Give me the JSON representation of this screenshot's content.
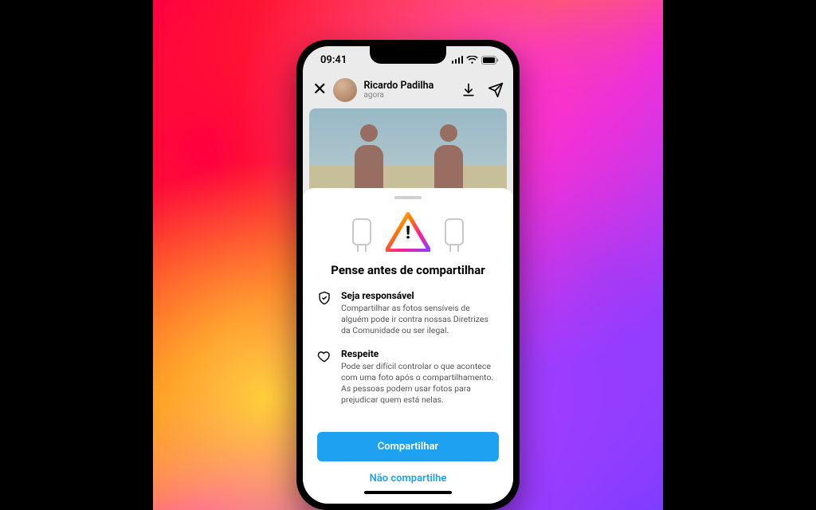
{
  "statusbar": {
    "time": "09:41"
  },
  "story": {
    "username": "Ricardo Padilha",
    "timestamp": "agora"
  },
  "sheet": {
    "title": "Pense antes de compartilhar",
    "items": [
      {
        "icon": "shield-check-icon",
        "title": "Seja responsável",
        "body": "Compartilhar as fotos sensíveis de alguém pode ir contra nossas Diretrizes da Comunidade ou ser ilegal."
      },
      {
        "icon": "heart-icon",
        "title": "Respeite",
        "body": "Pode ser difícil controlar o que acontece com uma foto após o compartilhamento. As pessoas podem usar fotos para prejudicar quem está nelas."
      }
    ],
    "primary_label": "Compartilhar",
    "secondary_label": "Não compartilhe"
  },
  "colors": {
    "primary_button": "#1fa1f2",
    "link": "#1fa1f2"
  }
}
